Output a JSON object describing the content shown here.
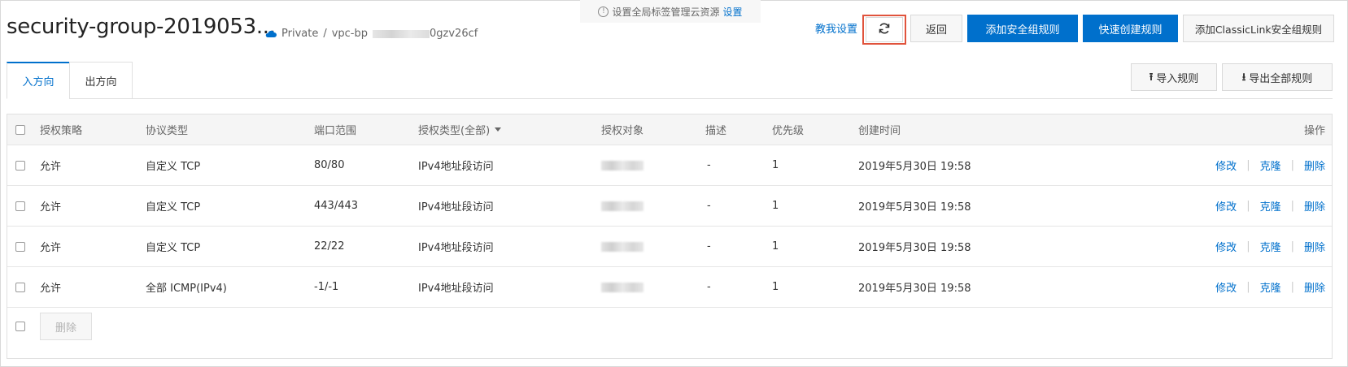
{
  "notice": {
    "text": "设置全局标签管理云资源",
    "link": "设置"
  },
  "header": {
    "title": "security-group-2019053...",
    "network_type": "Private",
    "vpc_prefix": "vpc-bp",
    "vpc_suffix": "0gzv26cf",
    "help_link": "教我设置",
    "back_label": "返回",
    "add_rule_label": "添加安全组规则",
    "quick_create_label": "快速创建规则",
    "add_classiclink_label": "添加ClassicLink安全组规则"
  },
  "tabs": [
    {
      "label": "入方向",
      "active": true
    },
    {
      "label": "出方向",
      "active": false
    }
  ],
  "toolbar": {
    "import_label": "导入规则",
    "export_label": "导出全部规则"
  },
  "table": {
    "headers": {
      "policy": "授权策略",
      "protocol": "协议类型",
      "port": "端口范围",
      "auth_type": "授权类型(全部)",
      "target": "授权对象",
      "description": "描述",
      "priority": "优先级",
      "created": "创建时间",
      "actions": "操作"
    },
    "rows": [
      {
        "policy": "允许",
        "protocol": "自定义 TCP",
        "port": "80/80",
        "auth_type": "IPv4地址段访问",
        "description": "-",
        "priority": "1",
        "created": "2019年5月30日 19:58"
      },
      {
        "policy": "允许",
        "protocol": "自定义 TCP",
        "port": "443/443",
        "auth_type": "IPv4地址段访问",
        "description": "-",
        "priority": "1",
        "created": "2019年5月30日 19:58"
      },
      {
        "policy": "允许",
        "protocol": "自定义 TCP",
        "port": "22/22",
        "auth_type": "IPv4地址段访问",
        "description": "-",
        "priority": "1",
        "created": "2019年5月30日 19:58"
      },
      {
        "policy": "允许",
        "protocol": "全部 ICMP(IPv4)",
        "port": "-1/-1",
        "auth_type": "IPv4地址段访问",
        "description": "-",
        "priority": "1",
        "created": "2019年5月30日 19:58"
      }
    ],
    "row_actions": {
      "edit": "修改",
      "clone": "克隆",
      "delete": "删除"
    },
    "bulk_delete_label": "删除"
  },
  "colors": {
    "primary": "#0070cc",
    "highlight_border": "#e0533c"
  }
}
